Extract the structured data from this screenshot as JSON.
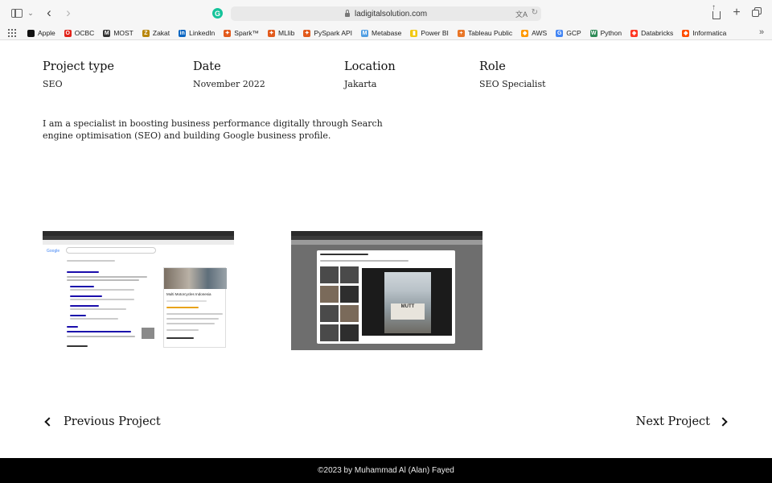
{
  "browser": {
    "url": "ladigitalsolution.com",
    "bookmarks": [
      {
        "label": "Apple",
        "icon": "apple-icon",
        "color": "#111111",
        "glyph": ""
      },
      {
        "label": "OCBC",
        "icon": "ocbc-icon",
        "color": "#e2231a",
        "glyph": "O"
      },
      {
        "label": "MOST",
        "icon": "most-icon",
        "color": "#333333",
        "glyph": "M"
      },
      {
        "label": "Zakat",
        "icon": "zakat-icon",
        "color": "#b8860b",
        "glyph": "Z"
      },
      {
        "label": "LinkedIn",
        "icon": "linkedin-icon",
        "color": "#0a66c2",
        "glyph": "in"
      },
      {
        "label": "Spark™",
        "icon": "spark-icon",
        "color": "#e25a1c",
        "glyph": "✦"
      },
      {
        "label": "MLlib",
        "icon": "mllib-icon",
        "color": "#e25a1c",
        "glyph": "✦"
      },
      {
        "label": "PySpark API",
        "icon": "pyspark-icon",
        "color": "#e25a1c",
        "glyph": "✦"
      },
      {
        "label": "Metabase",
        "icon": "metabase-icon",
        "color": "#509ee3",
        "glyph": "M"
      },
      {
        "label": "Power BI",
        "icon": "powerbi-icon",
        "color": "#f2c811",
        "glyph": "▮"
      },
      {
        "label": "Tableau Public",
        "icon": "tableau-icon",
        "color": "#e97627",
        "glyph": "+"
      },
      {
        "label": "AWS",
        "icon": "aws-icon",
        "color": "#ff9900",
        "glyph": "◆"
      },
      {
        "label": "GCP",
        "icon": "gcp-icon",
        "color": "#4285f4",
        "glyph": "G"
      },
      {
        "label": "Python",
        "icon": "python-icon",
        "color": "#2e8b57",
        "glyph": "W"
      },
      {
        "label": "Databricks",
        "icon": "databricks-icon",
        "color": "#ff3621",
        "glyph": "◈"
      },
      {
        "label": "Informatica",
        "icon": "informatica-icon",
        "color": "#ff4d00",
        "glyph": "◆"
      }
    ]
  },
  "project": {
    "type_label": "Project type",
    "type_value": "SEO",
    "date_label": "Date",
    "date_value": "November 2022",
    "location_label": "Location",
    "location_value": "Jakarta",
    "role_label": "Role",
    "role_value": "SEO Specialist",
    "description": "I am a specialist in boosting business performance digitally through Search engine optimisation (SEO) and building Google business profile."
  },
  "gallery": {
    "shot1": {
      "logo": "Google",
      "panel_title": "Multi Motorcycles Indonesia"
    },
    "shot2": {
      "sign_text": "MUTT"
    }
  },
  "nav": {
    "previous_label": "Previous Project",
    "next_label": "Next Project"
  },
  "footer": {
    "text": "©2023 by Muhammad Al (Alan) Fayed"
  }
}
